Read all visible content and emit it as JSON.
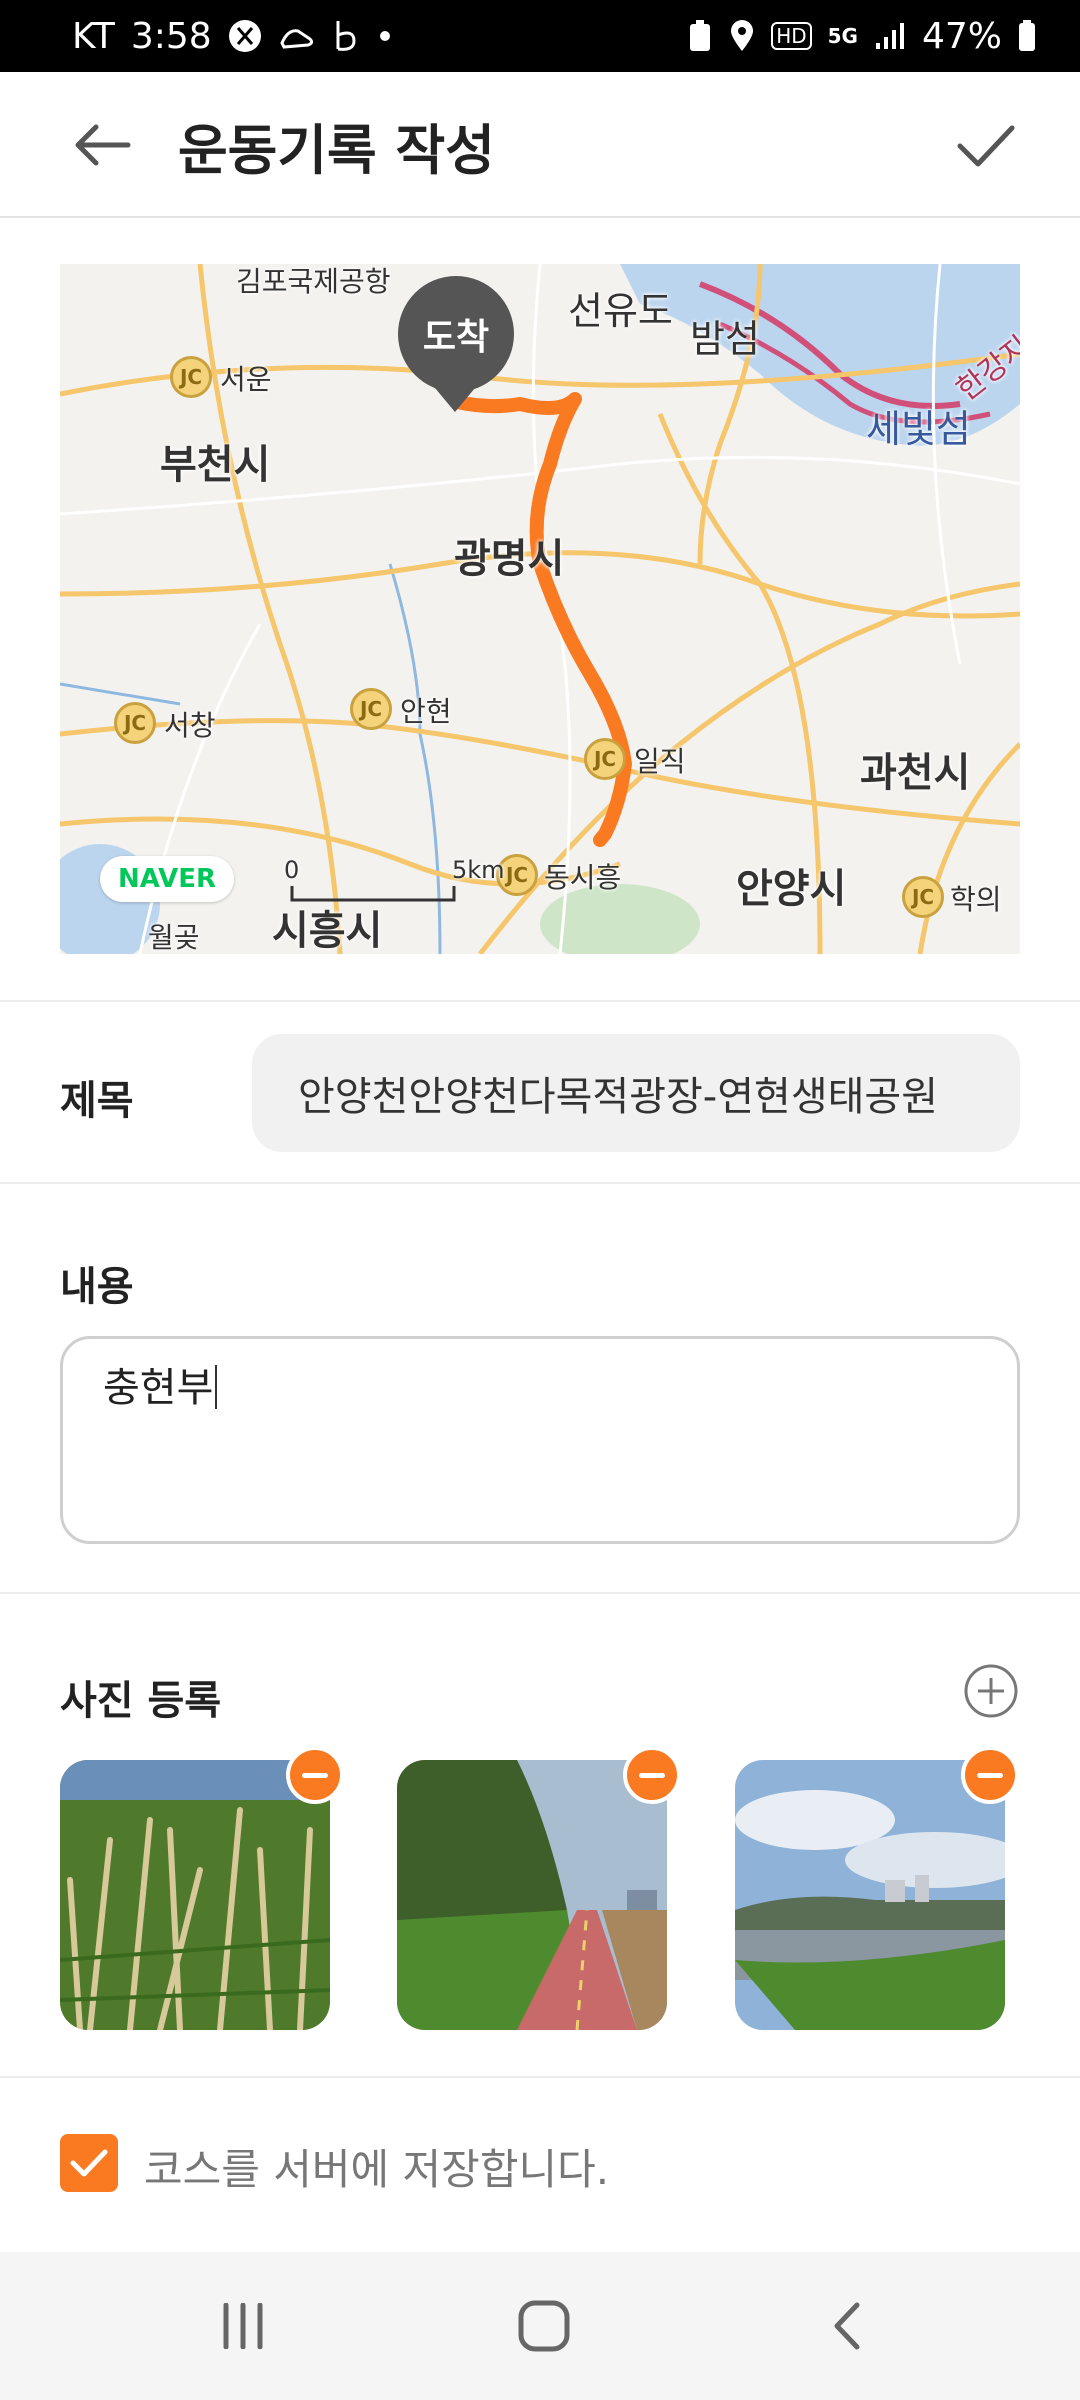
{
  "status_bar": {
    "carrier": "KT",
    "time": "3:58",
    "battery": "47%",
    "network": "5G",
    "hd": "HD"
  },
  "header": {
    "title": "운동기록 작성"
  },
  "map": {
    "pin_label": "도착",
    "provider": "NAVER",
    "scale_start": "0",
    "scale_end": "5km",
    "labels": {
      "gimpo": "김포국제공항",
      "seonyudo": "선유도",
      "bamseom": "밤섬",
      "hangang": "한강지",
      "sebitseom": "세빛섬",
      "seoun": "서운",
      "bucheon": "부천시",
      "gwangmyeong": "광명시",
      "seochang": "서창",
      "anhyeon": "안현",
      "iljik": "일직",
      "gwacheon": "과천시",
      "dongsiheung": "동시흥",
      "anyang": "안양시",
      "hakui": "학의",
      "wolgot": "월곶",
      "siheung": "시흥시"
    },
    "jc_badge": "JC",
    "route_color": "#fa7a22"
  },
  "form": {
    "title_label": "제목",
    "title_value": "안양천안양천다목적광장-연현생태공원",
    "content_label": "내용",
    "content_value": "충현부",
    "photo_label": "사진 등록",
    "save_course_label": "코스를 서버에 저장합니다.",
    "save_course_checked": true
  },
  "photos": [
    {
      "subject": "grass-field-photo"
    },
    {
      "subject": "bike-path-photo"
    },
    {
      "subject": "river-view-photo"
    }
  ],
  "colors": {
    "accent": "#fa7a22"
  }
}
